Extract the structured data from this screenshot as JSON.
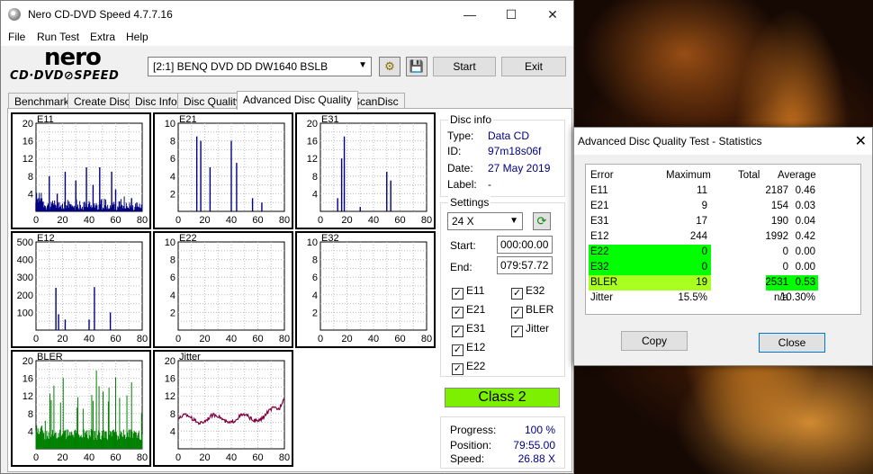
{
  "window": {
    "title": "Nero CD-DVD Speed 4.7.7.16",
    "min": "—",
    "max": "☐",
    "close": "✕"
  },
  "menu": [
    "File",
    "Run Test",
    "Extra",
    "Help"
  ],
  "logo": {
    "top": "nero",
    "bottom": "CD·DVD⊘SPEED"
  },
  "drive": "[2:1]   BENQ DVD DD DW1640 BSLB",
  "buttons": {
    "start": "Start",
    "exit": "Exit"
  },
  "tabs": [
    "Benchmark",
    "Create Disc",
    "Disc Info",
    "Disc Quality",
    "Advanced Disc Quality",
    "ScanDisc"
  ],
  "charts": [
    {
      "name": "E11",
      "yticks": [
        "20",
        "16",
        "12",
        "8",
        "4"
      ],
      "xticks": [
        "0",
        "20",
        "40",
        "60",
        "80"
      ]
    },
    {
      "name": "E21",
      "yticks": [
        "10",
        "8",
        "6",
        "4",
        "2"
      ],
      "xticks": [
        "0",
        "20",
        "40",
        "60",
        "80"
      ]
    },
    {
      "name": "E31",
      "yticks": [
        "20",
        "16",
        "12",
        "8",
        "4"
      ],
      "xticks": [
        "0",
        "20",
        "40",
        "60",
        "80"
      ]
    },
    {
      "name": "E12",
      "yticks": [
        "500",
        "400",
        "300",
        "200",
        "100"
      ],
      "xticks": [
        "0",
        "20",
        "40",
        "60",
        "80"
      ]
    },
    {
      "name": "E22",
      "yticks": [
        "10",
        "8",
        "6",
        "4",
        "2"
      ],
      "xticks": [
        "0",
        "20",
        "40",
        "60",
        "80"
      ]
    },
    {
      "name": "E32",
      "yticks": [
        "10",
        "8",
        "6",
        "4",
        "2"
      ],
      "xticks": [
        "0",
        "20",
        "40",
        "60",
        "80"
      ]
    },
    {
      "name": "BLER",
      "yticks": [
        "20",
        "16",
        "12",
        "8",
        "4"
      ],
      "xticks": [
        "0",
        "20",
        "40",
        "60",
        "80"
      ]
    },
    {
      "name": "Jitter",
      "yticks": [
        "20",
        "16",
        "12",
        "8",
        "4"
      ],
      "xticks": [
        "0",
        "20",
        "40",
        "60",
        "80"
      ]
    }
  ],
  "disc_info": {
    "title": "Disc info",
    "type_label": "Type:",
    "type": "Data CD",
    "id_label": "ID:",
    "id": "97m18s06f",
    "date_label": "Date:",
    "date": "27 May 2019",
    "label_label": "Label:",
    "label": "-"
  },
  "settings": {
    "title": "Settings",
    "speed": "24 X",
    "start_label": "Start:",
    "start": "000:00.00",
    "end_label": "End:",
    "end": "079:57.72",
    "checks": [
      "E11",
      "E32",
      "E21",
      "BLER",
      "E31",
      "Jitter",
      "E12",
      "E22"
    ]
  },
  "class": "Class 2",
  "progress": {
    "progress_label": "Progress:",
    "progress": "100 %",
    "position_label": "Position:",
    "position": "79:55.00",
    "speed_label": "Speed:",
    "speed": "26.88 X"
  },
  "stats": {
    "title": "Advanced Disc Quality Test - Statistics",
    "headers": [
      "Error",
      "Maximum",
      "Total",
      "Average"
    ],
    "rows": [
      [
        "E11",
        "11",
        "2187",
        "0.46"
      ],
      [
        "E21",
        "9",
        "154",
        "0.03"
      ],
      [
        "E31",
        "17",
        "190",
        "0.04"
      ],
      [
        "E12",
        "244",
        "1992",
        "0.42"
      ],
      [
        "E22",
        "0",
        "0",
        "0.00"
      ],
      [
        "E32",
        "0",
        "0",
        "0.00"
      ],
      [
        "BLER",
        "19",
        "2531",
        "0.53"
      ],
      [
        "Jitter",
        "15.5%",
        "n/a",
        "10.30%"
      ]
    ],
    "copy": "Copy",
    "close": "Close"
  },
  "colors": {
    "dark_blue": "#000080",
    "green": "#008000",
    "jitter": "#800040",
    "class_green": "#7cf000"
  }
}
